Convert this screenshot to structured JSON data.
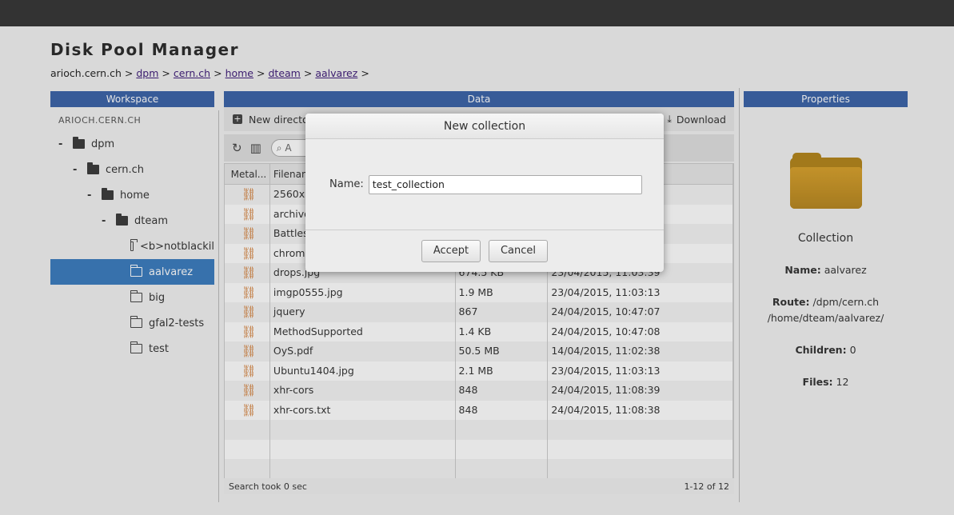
{
  "app": {
    "title": "Disk Pool Manager"
  },
  "breadcrumb": {
    "root": "arioch.cern.ch",
    "separator": ">",
    "links": [
      "dpm",
      "cern.ch",
      "home",
      "dteam",
      "aalvarez"
    ]
  },
  "panels": {
    "workspace": "Workspace",
    "data": "Data",
    "properties": "Properties"
  },
  "workspace": {
    "host": "ARIOCH.CERN.CH",
    "tree": [
      {
        "label": "dpm",
        "expander": "-"
      },
      {
        "label": "cern.ch",
        "expander": "-"
      },
      {
        "label": "home",
        "expander": "-"
      },
      {
        "label": "dteam",
        "expander": "-"
      },
      {
        "label": "<b>notblackil"
      },
      {
        "label": "aalvarez",
        "selected": true
      },
      {
        "label": "big"
      },
      {
        "label": "gfal2-tests"
      },
      {
        "label": "test"
      }
    ]
  },
  "data": {
    "toolbar": {
      "new_directory": "New directo",
      "download": "Download",
      "search_placeholder": "A"
    },
    "columns": [
      "Metal...",
      "Filenan",
      "",
      ""
    ],
    "rows": [
      {
        "name": "2560x1",
        "size": "",
        "date": ""
      },
      {
        "name": "archivo",
        "size": "",
        "date": ""
      },
      {
        "name": "Battles",
        "size": "",
        "date": ""
      },
      {
        "name": "chrome",
        "size": "",
        "date": ""
      },
      {
        "name": "drops.jpg",
        "size": "674.5 KB",
        "date": "23/04/2015, 11:03:39"
      },
      {
        "name": "imgp0555.jpg",
        "size": "1.9 MB",
        "date": "23/04/2015, 11:03:13"
      },
      {
        "name": "jquery",
        "size": "867",
        "date": "24/04/2015, 10:47:07"
      },
      {
        "name": "MethodSupported",
        "size": "1.4 KB",
        "date": "24/04/2015, 10:47:08"
      },
      {
        "name": "OyS.pdf",
        "size": "50.5 MB",
        "date": "14/04/2015, 11:02:38"
      },
      {
        "name": "Ubuntu1404.jpg",
        "size": "2.1 MB",
        "date": "23/04/2015, 11:03:13"
      },
      {
        "name": "xhr-cors",
        "size": "848",
        "date": "24/04/2015, 11:08:39"
      },
      {
        "name": "xhr-cors.txt",
        "size": "848",
        "date": "24/04/2015, 11:08:38"
      }
    ],
    "footer": {
      "search_time": "Search took 0 sec",
      "paging": "1-12 of 12"
    }
  },
  "properties": {
    "type": "Collection",
    "name_label": "Name:",
    "name": "aalvarez",
    "route_label": "Route:",
    "route_line1": "/dpm/cern.ch",
    "route_line2": "/home/dteam/aalvarez/",
    "children_label": "Children:",
    "children": "0",
    "files_label": "Files:",
    "files": "12"
  },
  "dialog": {
    "title": "New collection",
    "name_label": "Name:",
    "name_value": "test_collection",
    "accept": "Accept",
    "cancel": "Cancel"
  },
  "colors": {
    "panel_header": "#3a62a8",
    "selected": "#3a7bbf",
    "link_icon": "#d2762a",
    "folder": "#b3841a"
  }
}
